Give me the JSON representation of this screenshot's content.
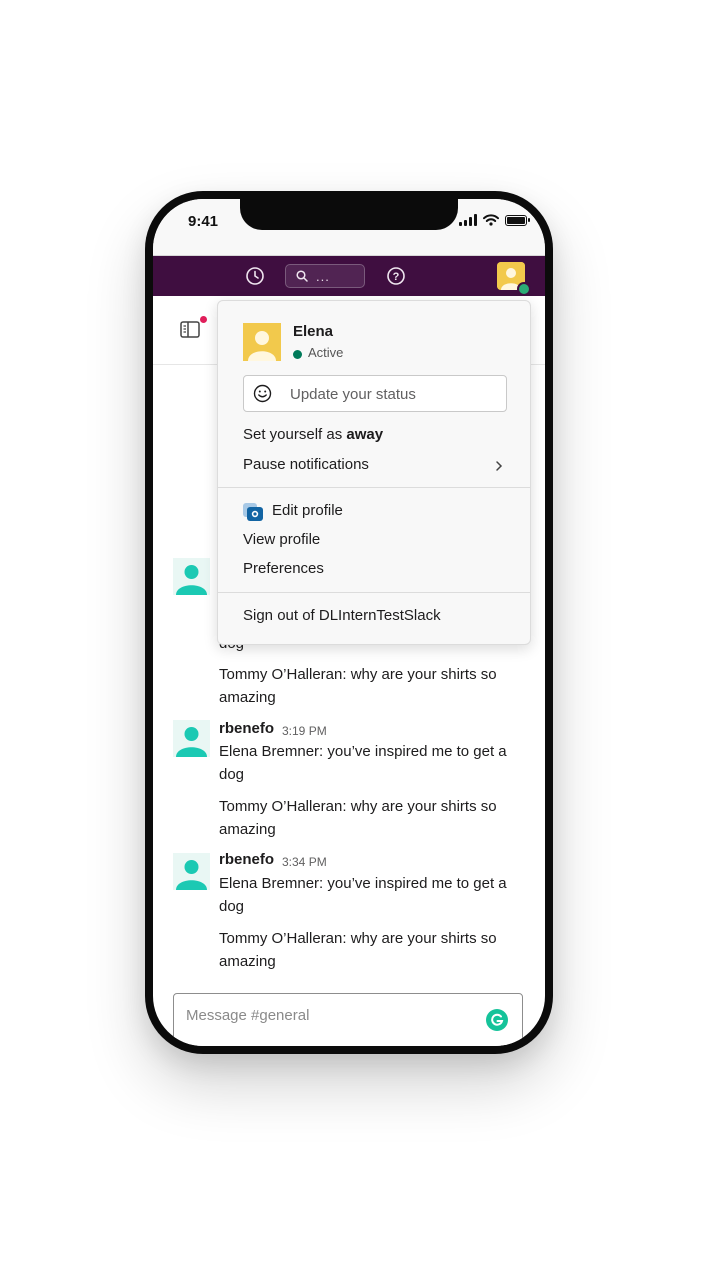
{
  "status_bar": {
    "time": "9:41"
  },
  "search": {
    "placeholder": "..."
  },
  "messages": [
    {
      "username": "",
      "time": "",
      "lines": [
        "dog",
        "Tommy O’Halleran: why are your shirts so",
        "amazing"
      ]
    },
    {
      "username": "rbenefo",
      "time": "3:19 PM",
      "lines": [
        "Elena Bremner: you’ve inspired me to get a",
        "dog",
        "Tommy O’Halleran: why are your shirts so",
        "amazing"
      ]
    },
    {
      "username": "rbenefo",
      "time": "3:34 PM",
      "lines": [
        "Elena Bremner: you’ve inspired me to get a",
        "dog",
        "Tommy O’Halleran: why are your shirts so",
        "amazing"
      ]
    }
  ],
  "composer": {
    "placeholder": "Message #general"
  },
  "profile_menu": {
    "name": "Elena",
    "presence": "Active",
    "status_placeholder": "Update your status",
    "set_away_prefix": "Set yourself as",
    "set_away_bold": "away",
    "pause_notifications": "Pause notifications",
    "edit_profile": "Edit profile",
    "view_profile": "View profile",
    "preferences": "Preferences",
    "sign_out": "Sign out of DLInternTestSlack"
  },
  "colors": {
    "topbar": "#3f0e40",
    "presence_green": "#2bac76",
    "avatar_teal": "#1bc9b3",
    "avatar_yellow": "#f2c94c",
    "badge_red": "#e01e5a",
    "grammarly_green": "#15c39a"
  },
  "icons": [
    "history-icon",
    "search-icon",
    "help-icon",
    "user-avatar",
    "sidebar-icon",
    "smiley-icon",
    "camera-profile-icon",
    "chevron-right-icon",
    "grammarly-icon"
  ]
}
